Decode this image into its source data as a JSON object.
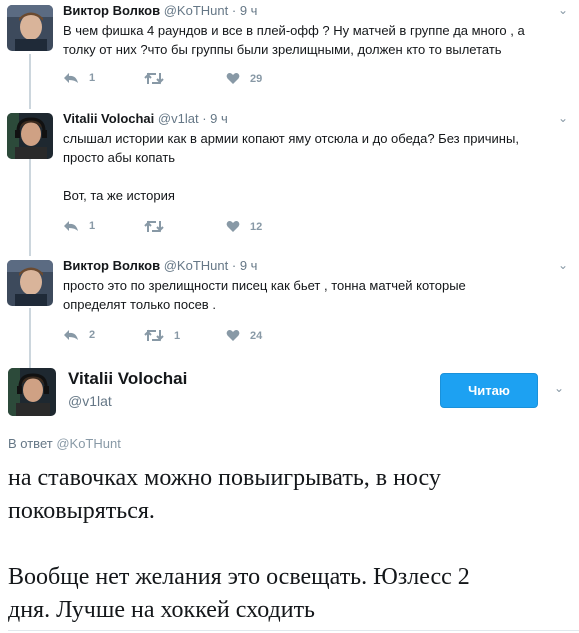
{
  "tweets": [
    {
      "name": "Виктор Волков",
      "handle": "@KoTHunt",
      "dot": "·",
      "time": "9 ч",
      "lines": [
        "В чем фишка 4 раундов и все в плей-офф ? Ну матчей в группе да много , а",
        "толку от них ?что бы группы были зрелищными, должен кто то вылетать"
      ],
      "replies": "1",
      "retweets": "",
      "likes": "29"
    },
    {
      "name": "Vitalii Volochai",
      "handle": "@v1lat",
      "dot": "·",
      "time": "9 ч",
      "lines": [
        "слышал истории как в армии копают яму отсюла и до обеда? Без причины,",
        "просто абы копать",
        "",
        "Вот, та же история"
      ],
      "replies": "1",
      "retweets": "",
      "likes": "12"
    },
    {
      "name": "Виктор Волков",
      "handle": "@KoTHunt",
      "dot": "·",
      "time": "9 ч",
      "lines": [
        "просто это по зрелищности писец как бьет , тонна матчей которые",
        "определят только посев ."
      ],
      "replies": "2",
      "retweets": "1",
      "likes": "24"
    }
  ],
  "main": {
    "name": "Vitalii Volochai",
    "handle": "@v1lat",
    "follow_label": "Читаю",
    "reply_prefix": "В ответ",
    "reply_handle": "@KoTHunt",
    "lines": [
      "на ставочках можно повыигрывать, в носу",
      "поковыряться.",
      "",
      "Вообще нет желания это освещать. Юзлесс 2",
      "дня. Лучше на хоккей сходить"
    ]
  },
  "colors": {
    "accent": "#1da1f2",
    "muted": "#8899a6",
    "thread_line": "#ccd6dd"
  },
  "icons": {
    "reply": "reply-icon",
    "retweet": "retweet-icon",
    "like": "heart-icon",
    "caret": "chevron-down-icon"
  }
}
